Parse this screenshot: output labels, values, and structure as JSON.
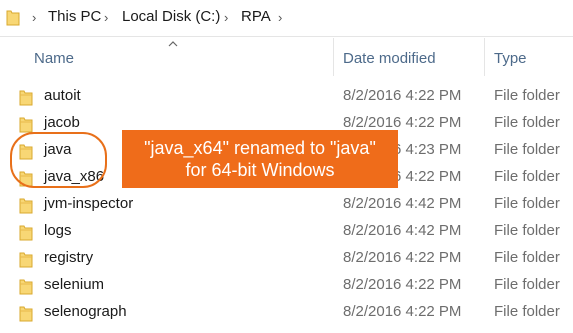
{
  "breadcrumb": {
    "items": [
      "This PC",
      "Local Disk (C:)",
      "RPA"
    ],
    "separator": "›"
  },
  "columns": {
    "name": "Name",
    "date_modified": "Date modified",
    "type": "Type"
  },
  "rows": [
    {
      "name": "autoit",
      "date": "8/2/2016 4:22 PM",
      "type": "File folder"
    },
    {
      "name": "jacob",
      "date": "8/2/2016 4:22 PM",
      "type": "File folder"
    },
    {
      "name": "java",
      "date": "8/2/2016 4:23 PM",
      "type": "File folder"
    },
    {
      "name": "java_x86",
      "date": "8/2/2016 4:22 PM",
      "type": "File folder"
    },
    {
      "name": "jvm-inspector",
      "date": "8/2/2016 4:42 PM",
      "type": "File folder"
    },
    {
      "name": "logs",
      "date": "8/2/2016 4:42 PM",
      "type": "File folder"
    },
    {
      "name": "registry",
      "date": "8/2/2016 4:22 PM",
      "type": "File folder"
    },
    {
      "name": "selenium",
      "date": "8/2/2016 4:22 PM",
      "type": "File folder"
    },
    {
      "name": "selenograph",
      "date": "8/2/2016 4:22 PM",
      "type": "File folder"
    }
  ],
  "annotation": {
    "line1": "\"java_x64\" renamed to \"java\"",
    "line2": "for 64-bit Windows"
  },
  "icons": {
    "folder": "folder-icon",
    "sort": "sort-up-icon"
  },
  "colors": {
    "folder": "#f8d775",
    "callout": "#ef6c1a",
    "header_text": "#4d6a8a"
  }
}
